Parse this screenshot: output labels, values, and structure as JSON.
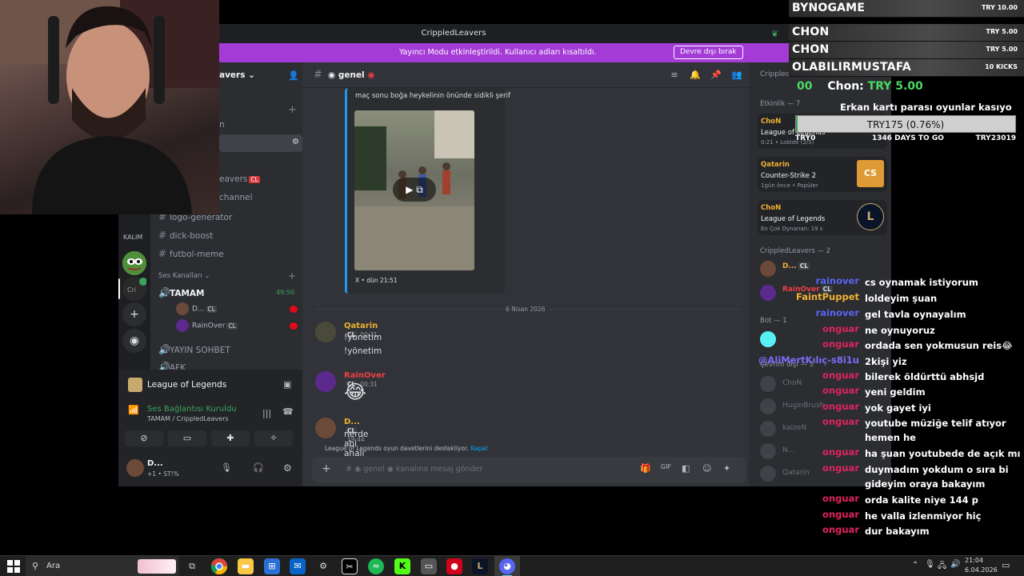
{
  "window": {
    "title": "CrippledLeavers"
  },
  "streamer_mode": {
    "message": "Yayıncı Modu etkinleştirildi. Kullanıcı adları kısaltıldı.",
    "button": "Devre dışı bırak"
  },
  "server": {
    "name_fragment": "avers"
  },
  "sidebar": {
    "fragments": [
      "n",
      "eavers",
      "channel"
    ],
    "channels": [
      "logo-generator",
      "dick-boost",
      "futbol-meme"
    ],
    "voice_header": "Ses Kanalları",
    "voice_channel": {
      "name": "TAMAM",
      "timer": "49:50"
    },
    "voice_users": [
      {
        "name": "D...",
        "tag": "CL"
      },
      {
        "name": "RainOver",
        "tag": "CL"
      }
    ],
    "other_voice": [
      "YAYIN SOHBET",
      "AFK"
    ],
    "rail_label": "KALIM"
  },
  "activity": {
    "game": "League of Legends",
    "connection": "Ses Bağlantısı Kuruldu",
    "channel_path": "TAMAM / CrippledLeavers"
  },
  "user_panel": {
    "name": "D...",
    "status": "+1 • ST!%"
  },
  "chat": {
    "channel": "genel",
    "embed_caption": "maç sonu boğa heykelinin önünde sidikli şerif",
    "embed_source": "X • dün 21:51",
    "date_divider": "6 Nisan 2026",
    "messages": [
      {
        "author": "Qatarin",
        "tag": "CL",
        "time": "00:31",
        "lines": [
          "!yonetim",
          "!yönetim"
        ],
        "color": "#f0b232"
      },
      {
        "author": "RainOver",
        "tag": "CL",
        "time": "00:31",
        "lines": [
          "😂"
        ],
        "color": "#f23f43"
      },
      {
        "author": "D...",
        "tag": "CL",
        "time": "19:44",
        "lines": [
          "nerde abi ahali"
        ],
        "color": "#f0b232"
      }
    ],
    "invite_notice": "League of Legends oyun davetlerini destekliyor.",
    "invite_close": "Kapat",
    "composer_placeholder": "kanalına mesaj gönder",
    "composer_channel": "genel"
  },
  "members": {
    "header_server": "CrippledLeavers",
    "activity_header": "Etkinlik — 7",
    "activities": [
      {
        "user": "ChoN",
        "game": "League of Legends",
        "meta": "0:21 • Lobide (2/5)"
      },
      {
        "user": "Qatarin",
        "game": "Counter-Strike 2",
        "meta": "1gün önce • Popüler"
      },
      {
        "user": "ChoN",
        "game": "League of Legends",
        "meta": "En Çok Oynanan: 19 s"
      }
    ],
    "group_header": "CrippledLeavers — 2",
    "group_members": [
      {
        "name": "D...",
        "tag": "CL"
      },
      {
        "name": "RainOver",
        "tag": "CL"
      }
    ],
    "bot_header": "Bot — 1",
    "offline_header": "Çevrim dışı — 5",
    "offline": [
      "ChoN",
      "HuginBrush",
      "kaizeN",
      "N...",
      "Qatarin"
    ]
  },
  "donations": [
    {
      "name": "BYNOGAME",
      "amount": "TRY 10.00"
    },
    {
      "name": "CHON",
      "amount": "TRY 5.00"
    },
    {
      "name": "CHON",
      "amount": "TRY 5.00"
    },
    {
      "name": "OLABILIRMUSTAFA",
      "amount": "10 KICKS"
    }
  ],
  "last_donation": {
    "prefix": "00",
    "name": "Chon:",
    "amount": "TRY 5.00"
  },
  "goal": {
    "title": "Erkan kartı parası oyunlar kasıyo",
    "text": "TRY175 (0.76%)",
    "percent": 0.76,
    "left": "TRY0",
    "days": "1346 DAYS TO GO",
    "right": "TRY23019"
  },
  "stream_chat": [
    {
      "user": "rainover",
      "text": "cs oynamak istiyorum",
      "color": "#5865f2"
    },
    {
      "user": "FaintPuppet",
      "text": "loldeyim şuan",
      "color": "#f0b232"
    },
    {
      "user": "rainover",
      "text": "gel tavla oynayalım",
      "color": "#5865f2"
    },
    {
      "user": "onguar",
      "text": "ne oynuyoruz",
      "color": "#e0245e"
    },
    {
      "user": "onguar",
      "text": "ordada sen yokmusun reis😂",
      "color": "#e0245e"
    },
    {
      "user": "@AliMertKılıç-s8i1u",
      "text": "2kişi yiz",
      "color": "#7b6cf6"
    },
    {
      "user": "onguar",
      "text": "bilerek öldürttü abhsjd",
      "color": "#e0245e"
    },
    {
      "user": "onguar",
      "text": "yeni geldim",
      "color": "#e0245e"
    },
    {
      "user": "onguar",
      "text": "yok gayet iyi",
      "color": "#e0245e"
    },
    {
      "user": "onguar",
      "text": "youtube müziğe telif atıyor hemen he",
      "color": "#e0245e"
    },
    {
      "user": "onguar",
      "text": "ha şuan youtubede de açık mı",
      "color": "#e0245e"
    },
    {
      "user": "onguar",
      "text": "duymadım yokdum o sıra bi gideyim oraya bakayım",
      "color": "#e0245e"
    },
    {
      "user": "onguar",
      "text": "orda kalite niye 144 p",
      "color": "#e0245e"
    },
    {
      "user": "onguar",
      "text": "he valla izlenmiyor hiç",
      "color": "#e0245e"
    },
    {
      "user": "onguar",
      "text": "dur bakayım",
      "color": "#e0245e"
    }
  ],
  "taskbar": {
    "search_placeholder": "Ara",
    "time": "21:04",
    "date": "6.04.2026"
  }
}
